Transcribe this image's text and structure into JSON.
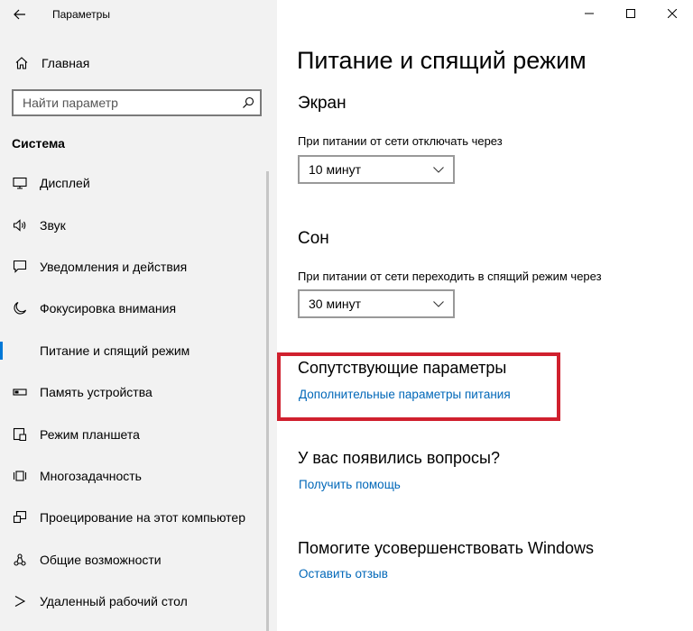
{
  "window": {
    "title": "Параметры"
  },
  "sidebar": {
    "home_label": "Главная",
    "search_placeholder": "Найти параметр",
    "section_label": "Система",
    "items": [
      {
        "label": "Дисплей",
        "icon": "monitor-icon"
      },
      {
        "label": "Звук",
        "icon": "speaker-icon"
      },
      {
        "label": "Уведомления и действия",
        "icon": "notification-icon"
      },
      {
        "label": "Фокусировка внимания",
        "icon": "moon-icon"
      },
      {
        "label": "Питание и спящий режим",
        "icon": "power-icon",
        "selected": true
      },
      {
        "label": "Память устройства",
        "icon": "storage-icon"
      },
      {
        "label": "Режим планшета",
        "icon": "tablet-icon"
      },
      {
        "label": "Многозадачность",
        "icon": "multitask-icon"
      },
      {
        "label": "Проецирование на этот компьютер",
        "icon": "projection-icon"
      },
      {
        "label": "Общие возможности",
        "icon": "shared-experiences-icon"
      },
      {
        "label": "Удаленный рабочий стол",
        "icon": "remote-desktop-icon"
      }
    ]
  },
  "main": {
    "title": "Питание и спящий режим",
    "screen": {
      "heading": "Экран",
      "description": "При питании от сети отключать через",
      "value": "10 минут"
    },
    "sleep": {
      "heading": "Сон",
      "description": "При питании от сети переходить в спящий режим через",
      "value": "30 минут"
    },
    "related": {
      "heading": "Сопутствующие параметры",
      "link": "Дополнительные параметры питания"
    },
    "questions": {
      "heading": "У вас появились вопросы?",
      "link": "Получить помощь"
    },
    "improve": {
      "heading": "Помогите усовершенствовать Windows",
      "link": "Оставить отзыв"
    }
  },
  "colors": {
    "accent": "#0078d7",
    "link": "#0067b8",
    "highlight": "#d0202e"
  }
}
